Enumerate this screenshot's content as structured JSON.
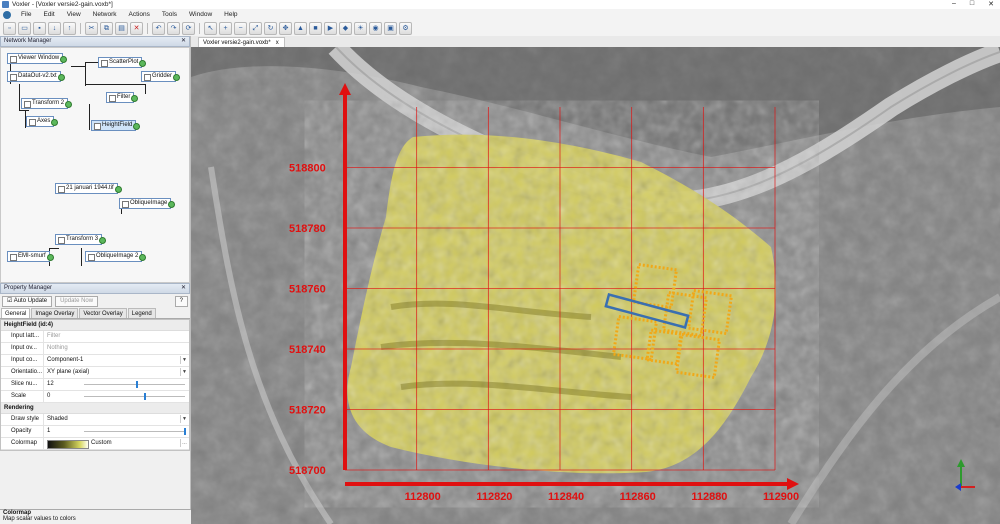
{
  "window": {
    "title": "Voxler - [Voxler versie2-gain.voxb*]",
    "buttons": [
      "–",
      "□",
      "✕"
    ]
  },
  "menu": [
    "File",
    "Edit",
    "View",
    "Network",
    "Actions",
    "Tools",
    "Window",
    "Help"
  ],
  "network_manager": {
    "title": "Network Manager",
    "nodes": [
      {
        "label": "Viewer Window",
        "check": false
      },
      {
        "label": "DataOut-v2.txt",
        "check": false
      },
      {
        "label": "ScatterPlot",
        "check": true
      },
      {
        "label": "Gridder",
        "check": false
      },
      {
        "label": "Transform 2",
        "check": false
      },
      {
        "label": "Filter",
        "check": false
      },
      {
        "label": "Axes",
        "check": true
      },
      {
        "label": "HeightField",
        "check": true
      },
      {
        "label": "21 januari 1944.tif",
        "check": false
      },
      {
        "label": "ObliqueImage",
        "check": true
      },
      {
        "label": "Transform 3",
        "check": false
      },
      {
        "label": "EMI-smurf",
        "check": false
      },
      {
        "label": "ObliqueImage 2",
        "check": true
      }
    ]
  },
  "property_manager": {
    "title": "Property Manager",
    "auto_update": "Auto Update",
    "update_now": "Update Now",
    "help": "?",
    "tabs": [
      "General",
      "Image Overlay",
      "Vector Overlay",
      "Legend"
    ],
    "group": "HeightField (id:4)",
    "rows": [
      {
        "k": "Input latt...",
        "v": "Filter",
        "ph": true
      },
      {
        "k": "Input ov...",
        "v": "Nothing",
        "ph": true
      },
      {
        "k": "Input co...",
        "v": "Component-1",
        "dd": true
      },
      {
        "k": "Orientatio...",
        "v": "XY plane (axial)",
        "dd": true
      },
      {
        "k": "Slice nu...",
        "v": "12",
        "slider": 0.52
      },
      {
        "k": "Scale",
        "v": "0",
        "slider": 0.6
      }
    ],
    "rendering": "Rendering",
    "rows2": [
      {
        "k": "Draw style",
        "v": "Shaded",
        "dd": true
      },
      {
        "k": "Opacity",
        "v": "1",
        "slider": 1.0
      },
      {
        "k": "Colormap",
        "v": "Custom",
        "cmap": true
      }
    ],
    "bottom_title": "Colormap",
    "bottom_text": "Map scalar values to colors"
  },
  "doc_tab": {
    "label": "Voxler versie2-gain.voxb*",
    "close": "x"
  },
  "plot": {
    "x_ticks": [
      "112800",
      "112820",
      "112840",
      "112860",
      "112880",
      "112900"
    ],
    "y_ticks": [
      "518700",
      "518720",
      "518740",
      "518760",
      "518780",
      "518800"
    ],
    "axis_color": "#e01010",
    "overlay_color": "#d8d060",
    "box_color": "#f0a818",
    "line_color": "#3a6fb0"
  }
}
